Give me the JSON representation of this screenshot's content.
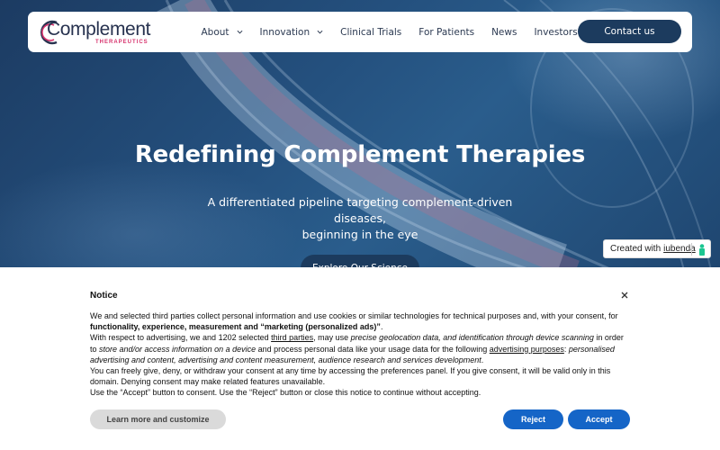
{
  "brand": {
    "name": "Complement",
    "tagline": "THERAPEUTICS",
    "navy": "#1c3b5e",
    "pink": "#d7336d"
  },
  "nav": {
    "items": [
      {
        "label": "About",
        "dropdown": true
      },
      {
        "label": "Innovation",
        "dropdown": true
      },
      {
        "label": "Clinical Trials",
        "dropdown": false
      },
      {
        "label": "For Patients",
        "dropdown": false
      },
      {
        "label": "News",
        "dropdown": false
      },
      {
        "label": "Investors",
        "dropdown": false
      }
    ],
    "contact_label": "Contact us"
  },
  "hero": {
    "title": "Redefining Complement Therapies",
    "subtitle_line1": "A differentiated pipeline targeting complement-driven diseases,",
    "subtitle_line2": "beginning in the eye",
    "cta_label": "Explore Our Science"
  },
  "iubenda": {
    "prefix": "Created with",
    "link": "iubenda"
  },
  "consent": {
    "title": "Notice",
    "close_icon": "close-icon",
    "p1_a": "We and selected third parties collect personal information and use cookies or similar technologies for technical purposes and, with your consent, for ",
    "p1_b": "functionality, experience, measurement and “marketing (personalized ads)”",
    "p1_c": ".",
    "p2_a": "With respect to advertising, we and 1202 selected ",
    "p2_link": "third parties",
    "p2_b": ", may use ",
    "p2_c": "precise geolocation data, and identification through device scanning",
    "p2_d": " in order to ",
    "p2_e": "store and/or access information on a device",
    "p2_f": " and process personal data like your usage data for the following ",
    "p2_link2": "advertising purposes",
    "p2_g": ": ",
    "p2_h": "personalised advertising and content, advertising and content measurement, audience research and services development",
    "p2_i": ".",
    "p3": "You can freely give, deny, or withdraw your consent at any time by accessing the preferences panel. If you give consent, it will be valid only in this domain. Denying consent may make related features unavailable.",
    "p4": "Use the “Accept” button to consent. Use the “Reject” button or close this notice to continue without accepting.",
    "learn_label": "Learn more and customize",
    "reject_label": "Reject",
    "accept_label": "Accept",
    "button_blue": "#1565c7"
  }
}
